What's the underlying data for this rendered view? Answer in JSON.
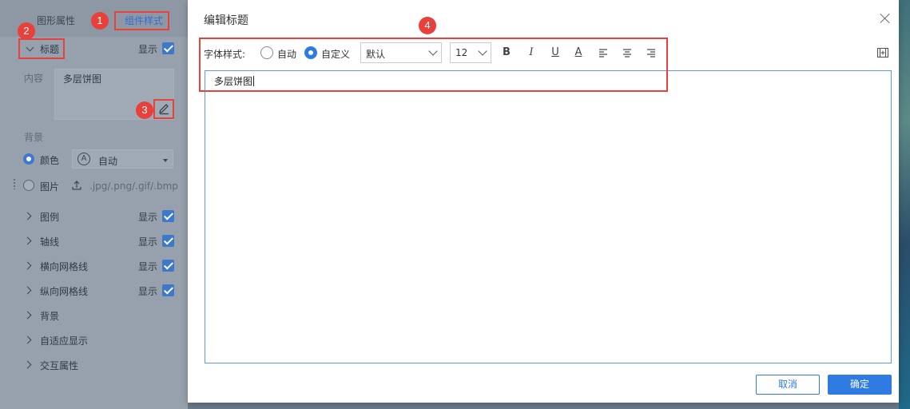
{
  "left_panel": {
    "tabs": [
      "图形属性",
      "组件样式"
    ],
    "title_section": {
      "label": "标题",
      "show_label": "显示"
    },
    "content_label": "内容",
    "content_value": "多层饼图",
    "background_label": "背景",
    "color_option": {
      "label": "颜色",
      "select_value": "自动",
      "select_icon_letter": "A"
    },
    "image_option": {
      "label": "图片",
      "hint": ".jpg/.png/.gif/.bmp"
    },
    "sections": [
      {
        "label": "图例",
        "show_label": "显示",
        "checked": true
      },
      {
        "label": "轴线",
        "show_label": "显示",
        "checked": true
      },
      {
        "label": "横向网格线",
        "show_label": "显示",
        "checked": true
      },
      {
        "label": "纵向网格线",
        "show_label": "显示",
        "checked": true
      },
      {
        "label": "背景"
      },
      {
        "label": "自适应显示"
      },
      {
        "label": "交互属性"
      }
    ]
  },
  "badges": [
    "1",
    "2",
    "3",
    "4"
  ],
  "dialog": {
    "title": "编辑标题",
    "font_style_label": "字体样式:",
    "radio_auto": "自动",
    "radio_custom": "自定义",
    "font_family": "默认",
    "font_size": "12",
    "tools": {
      "bold": "B",
      "italic": "I",
      "underline": "U",
      "font_color": "A"
    },
    "editor_text": "多层饼图",
    "cancel_label": "取消",
    "ok_label": "确定"
  },
  "colors": {
    "accent": "#2f7be2",
    "annotation": "#e8413b"
  }
}
